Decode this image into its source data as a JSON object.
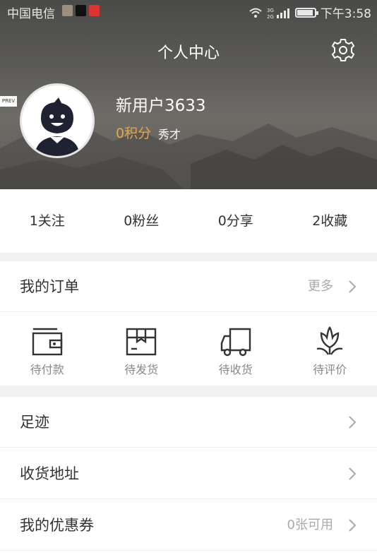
{
  "status_bar": {
    "carrier": "中国电信",
    "network": "3G 2G",
    "time": "下午3:58"
  },
  "header": {
    "title": "个人中心",
    "prev_tag": "PREV",
    "username": "新用户3633",
    "points": "0积分",
    "rank": "秀才"
  },
  "stats": [
    {
      "label": "1关注"
    },
    {
      "label": "0粉丝"
    },
    {
      "label": "0分享"
    },
    {
      "label": "2收藏"
    }
  ],
  "my_orders": {
    "label": "我的订单",
    "more": "更多"
  },
  "order_tabs": [
    {
      "label": "待付款",
      "icon": "wallet-icon"
    },
    {
      "label": "待发货",
      "icon": "package-icon"
    },
    {
      "label": "待收货",
      "icon": "truck-icon"
    },
    {
      "label": "待评价",
      "icon": "flower-icon"
    }
  ],
  "menu": {
    "footprint": "足迹",
    "address": "收货地址",
    "coupons": "我的优惠券",
    "coupons_hint": "0张可用"
  },
  "colors": {
    "accent_points": "#e0a84a",
    "header_bg": "#5b5a57",
    "divider": "#f1f1f1"
  }
}
